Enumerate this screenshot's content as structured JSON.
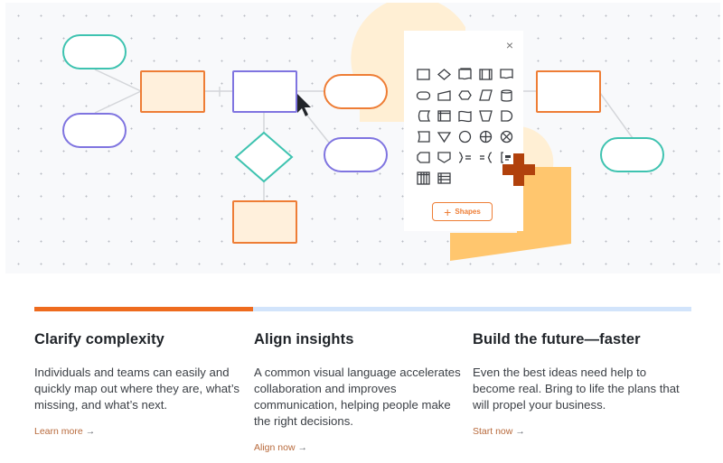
{
  "canvas": {
    "colors": {
      "teal": "#3ec3b0",
      "purple": "#7f74e0",
      "orange": "#ee7d35",
      "orange_fill": "#fff0dc",
      "connector": "#d4d6da",
      "blob_light": "#ffefd4",
      "blob_dark": "#ffc66e",
      "cross": "#b1410c"
    },
    "cursor_icon": "arrow-pointer-icon"
  },
  "shape_panel": {
    "close_icon": "close-icon",
    "close_label": "×",
    "shapes": [
      "rectangle",
      "diamond",
      "document",
      "process",
      "wave-document",
      "terminator",
      "manual-input",
      "hexagon",
      "parallelogram",
      "database",
      "stored-data",
      "internal-storage",
      "flag",
      "trapezoid",
      "delay",
      "card",
      "triangle-down",
      "circle",
      "crosshair-circle",
      "x-circle",
      "display",
      "off-page-shield",
      "brace-right-note",
      "brace-left-note",
      "bracket-note",
      "vertical-table",
      "horizontal-table"
    ],
    "add_button_icon": "+",
    "add_button_label": "Shapes"
  },
  "progress": {
    "value": 0.333
  },
  "features": [
    {
      "title": "Clarify complexity",
      "body": "Individuals and teams can easily and quickly map out where they are, what’s missing, and what’s next.",
      "link_label": "Learn more",
      "arrow": "→"
    },
    {
      "title": "Align insights",
      "body": "A common visual language accelerates collaboration and improves communication, helping people make the right decisions.",
      "link_label": "Align now",
      "arrow": "→"
    },
    {
      "title": "Build the future—faster",
      "body": "Even the best ideas need help to become real. Bring to life the plans that will propel your business.",
      "link_label": "Start now",
      "arrow": "→"
    }
  ]
}
